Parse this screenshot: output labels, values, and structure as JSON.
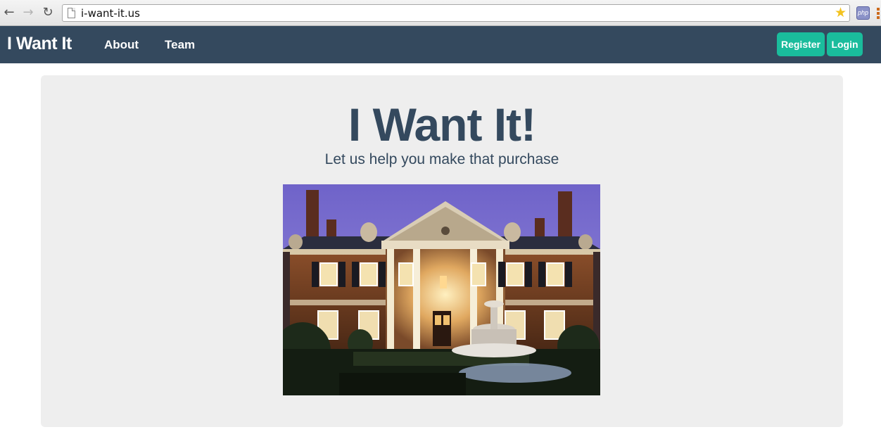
{
  "browser": {
    "url": "i-want-it.us",
    "extension_label": "php"
  },
  "navbar": {
    "brand": "I Want It",
    "links": [
      "About",
      "Team"
    ],
    "register_label": "Register",
    "login_label": "Login"
  },
  "hero": {
    "title": "I Want It!",
    "subtitle": "Let us help you make that purchase"
  },
  "colors": {
    "navbar_bg": "#34495e",
    "accent_button": "#1abc9c",
    "jumbotron_bg": "#eeeeee",
    "heading": "#34495e"
  },
  "icons": [
    "back-arrow-icon",
    "forward-arrow-icon",
    "reload-icon",
    "page-icon",
    "star-bookmark-icon",
    "php-extension-icon",
    "menu-icon"
  ]
}
